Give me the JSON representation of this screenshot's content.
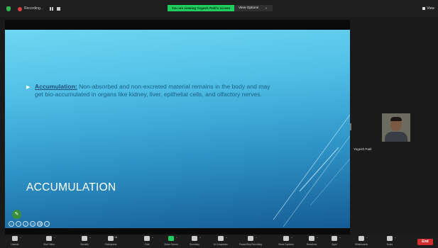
{
  "topbar": {
    "recording_label": "Recording...",
    "share_banner": "You are viewing Yogesh Patil's screen",
    "view_options_label": "View Options",
    "view_label": "View"
  },
  "slide": {
    "bullet_term": "Accumulation:",
    "bullet_text": " Non-absorbed and non-excreted material remains in the body and may get bio-accumulated in organs like kidney, liver, epithelial cells, and olfactory nerves.",
    "title": "ACCUMULATION"
  },
  "participant": {
    "name": "Yogesh Patil"
  },
  "toolbar": {
    "items": [
      {
        "label": "Unmute",
        "icon": "microphone-muted-icon",
        "color": "#cccccc"
      },
      {
        "label": "Start Video",
        "icon": "video-off-icon",
        "color": "#cccccc"
      },
      {
        "label": "Security",
        "icon": "shield-icon",
        "color": "#cccccc"
      },
      {
        "label": "Participants",
        "icon": "participants-icon",
        "color": "#cccccc",
        "count": "16"
      },
      {
        "label": "Chat",
        "icon": "chat-icon",
        "color": "#cccccc"
      },
      {
        "label": "Share Screen",
        "icon": "share-screen-icon",
        "color": "#1fcd5e"
      },
      {
        "label": "Summary",
        "icon": "summary-icon",
        "color": "#cccccc"
      },
      {
        "label": "AI Companion",
        "icon": "ai-companion-icon",
        "color": "#cccccc"
      },
      {
        "label": "Pause/Stop Recording",
        "icon": "pause-stop-recording-icon",
        "color": "#cccccc"
      },
      {
        "label": "Show Captions",
        "icon": "captions-icon",
        "color": "#cccccc"
      },
      {
        "label": "Reactions",
        "icon": "reactions-icon",
        "color": "#cccccc"
      },
      {
        "label": "Apps",
        "icon": "apps-icon",
        "color": "#cccccc"
      },
      {
        "label": "Whiteboards",
        "icon": "whiteboard-icon",
        "color": "#cccccc"
      },
      {
        "label": "Notes",
        "icon": "notes-icon",
        "color": "#cccccc"
      }
    ],
    "end_label": "End"
  }
}
